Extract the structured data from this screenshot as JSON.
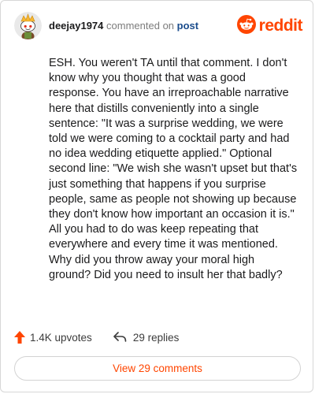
{
  "header": {
    "username": "deejay1974",
    "commented_on": "commented on",
    "post_link": "post",
    "brand": "reddit",
    "brand_color": "#ff4500",
    "avatar_icon": "snoo-avatar-icon",
    "brand_icon": "reddit-logo-icon"
  },
  "comment": {
    "text": "ESH. You weren't TA until that comment. I don't know why you thought that was a good response. You have an irreproachable narrative here that distills conveniently into a single sentence: \"It was a surprise wedding, we were told we were coming to a cocktail party and had no idea wedding etiquette applied.\" Optional second line: \"We wish she wasn't upset but that's just something that happens if you surprise people, same as people not showing up because they don't know how important an occasion it is.\" All you had to do was keep repeating that everywhere and every time it was mentioned. Why did you throw away your moral high ground? Did you need to insult her that badly?"
  },
  "footer": {
    "upvotes": "1.4K upvotes",
    "replies": "29 replies",
    "upvote_icon": "upvote-arrow-icon",
    "reply_icon": "reply-arrow-icon"
  },
  "view_comments": {
    "label": "View 29 comments"
  }
}
